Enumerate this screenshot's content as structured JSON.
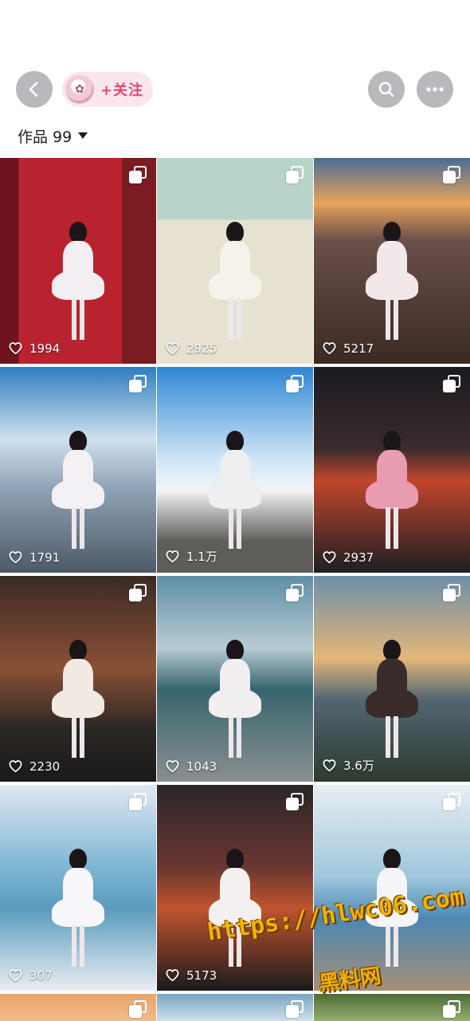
{
  "header": {
    "back_icon": "chevron-left-icon",
    "follow_label": "+关注",
    "search_icon": "search-icon",
    "more_icon": "ellipsis-icon"
  },
  "works": {
    "label": "作品 99"
  },
  "posts": [
    {
      "likes": "1994"
    },
    {
      "likes": "2925"
    },
    {
      "likes": "5217"
    },
    {
      "likes": "1791"
    },
    {
      "likes": "1.1万"
    },
    {
      "likes": "2937"
    },
    {
      "likes": "2230"
    },
    {
      "likes": "1043"
    },
    {
      "likes": "3.6万"
    },
    {
      "likes": "307"
    },
    {
      "likes": "5173"
    },
    {
      "likes": ""
    },
    {
      "likes": ""
    },
    {
      "likes": ""
    },
    {
      "likes": ""
    }
  ],
  "watermark": {
    "url": "https://hlwc06.com",
    "text": "黑料网"
  },
  "colors": {
    "follow_text": "#e1466f",
    "follow_bg": "#fbe6ee",
    "button_gray": "#b9b9bd"
  }
}
